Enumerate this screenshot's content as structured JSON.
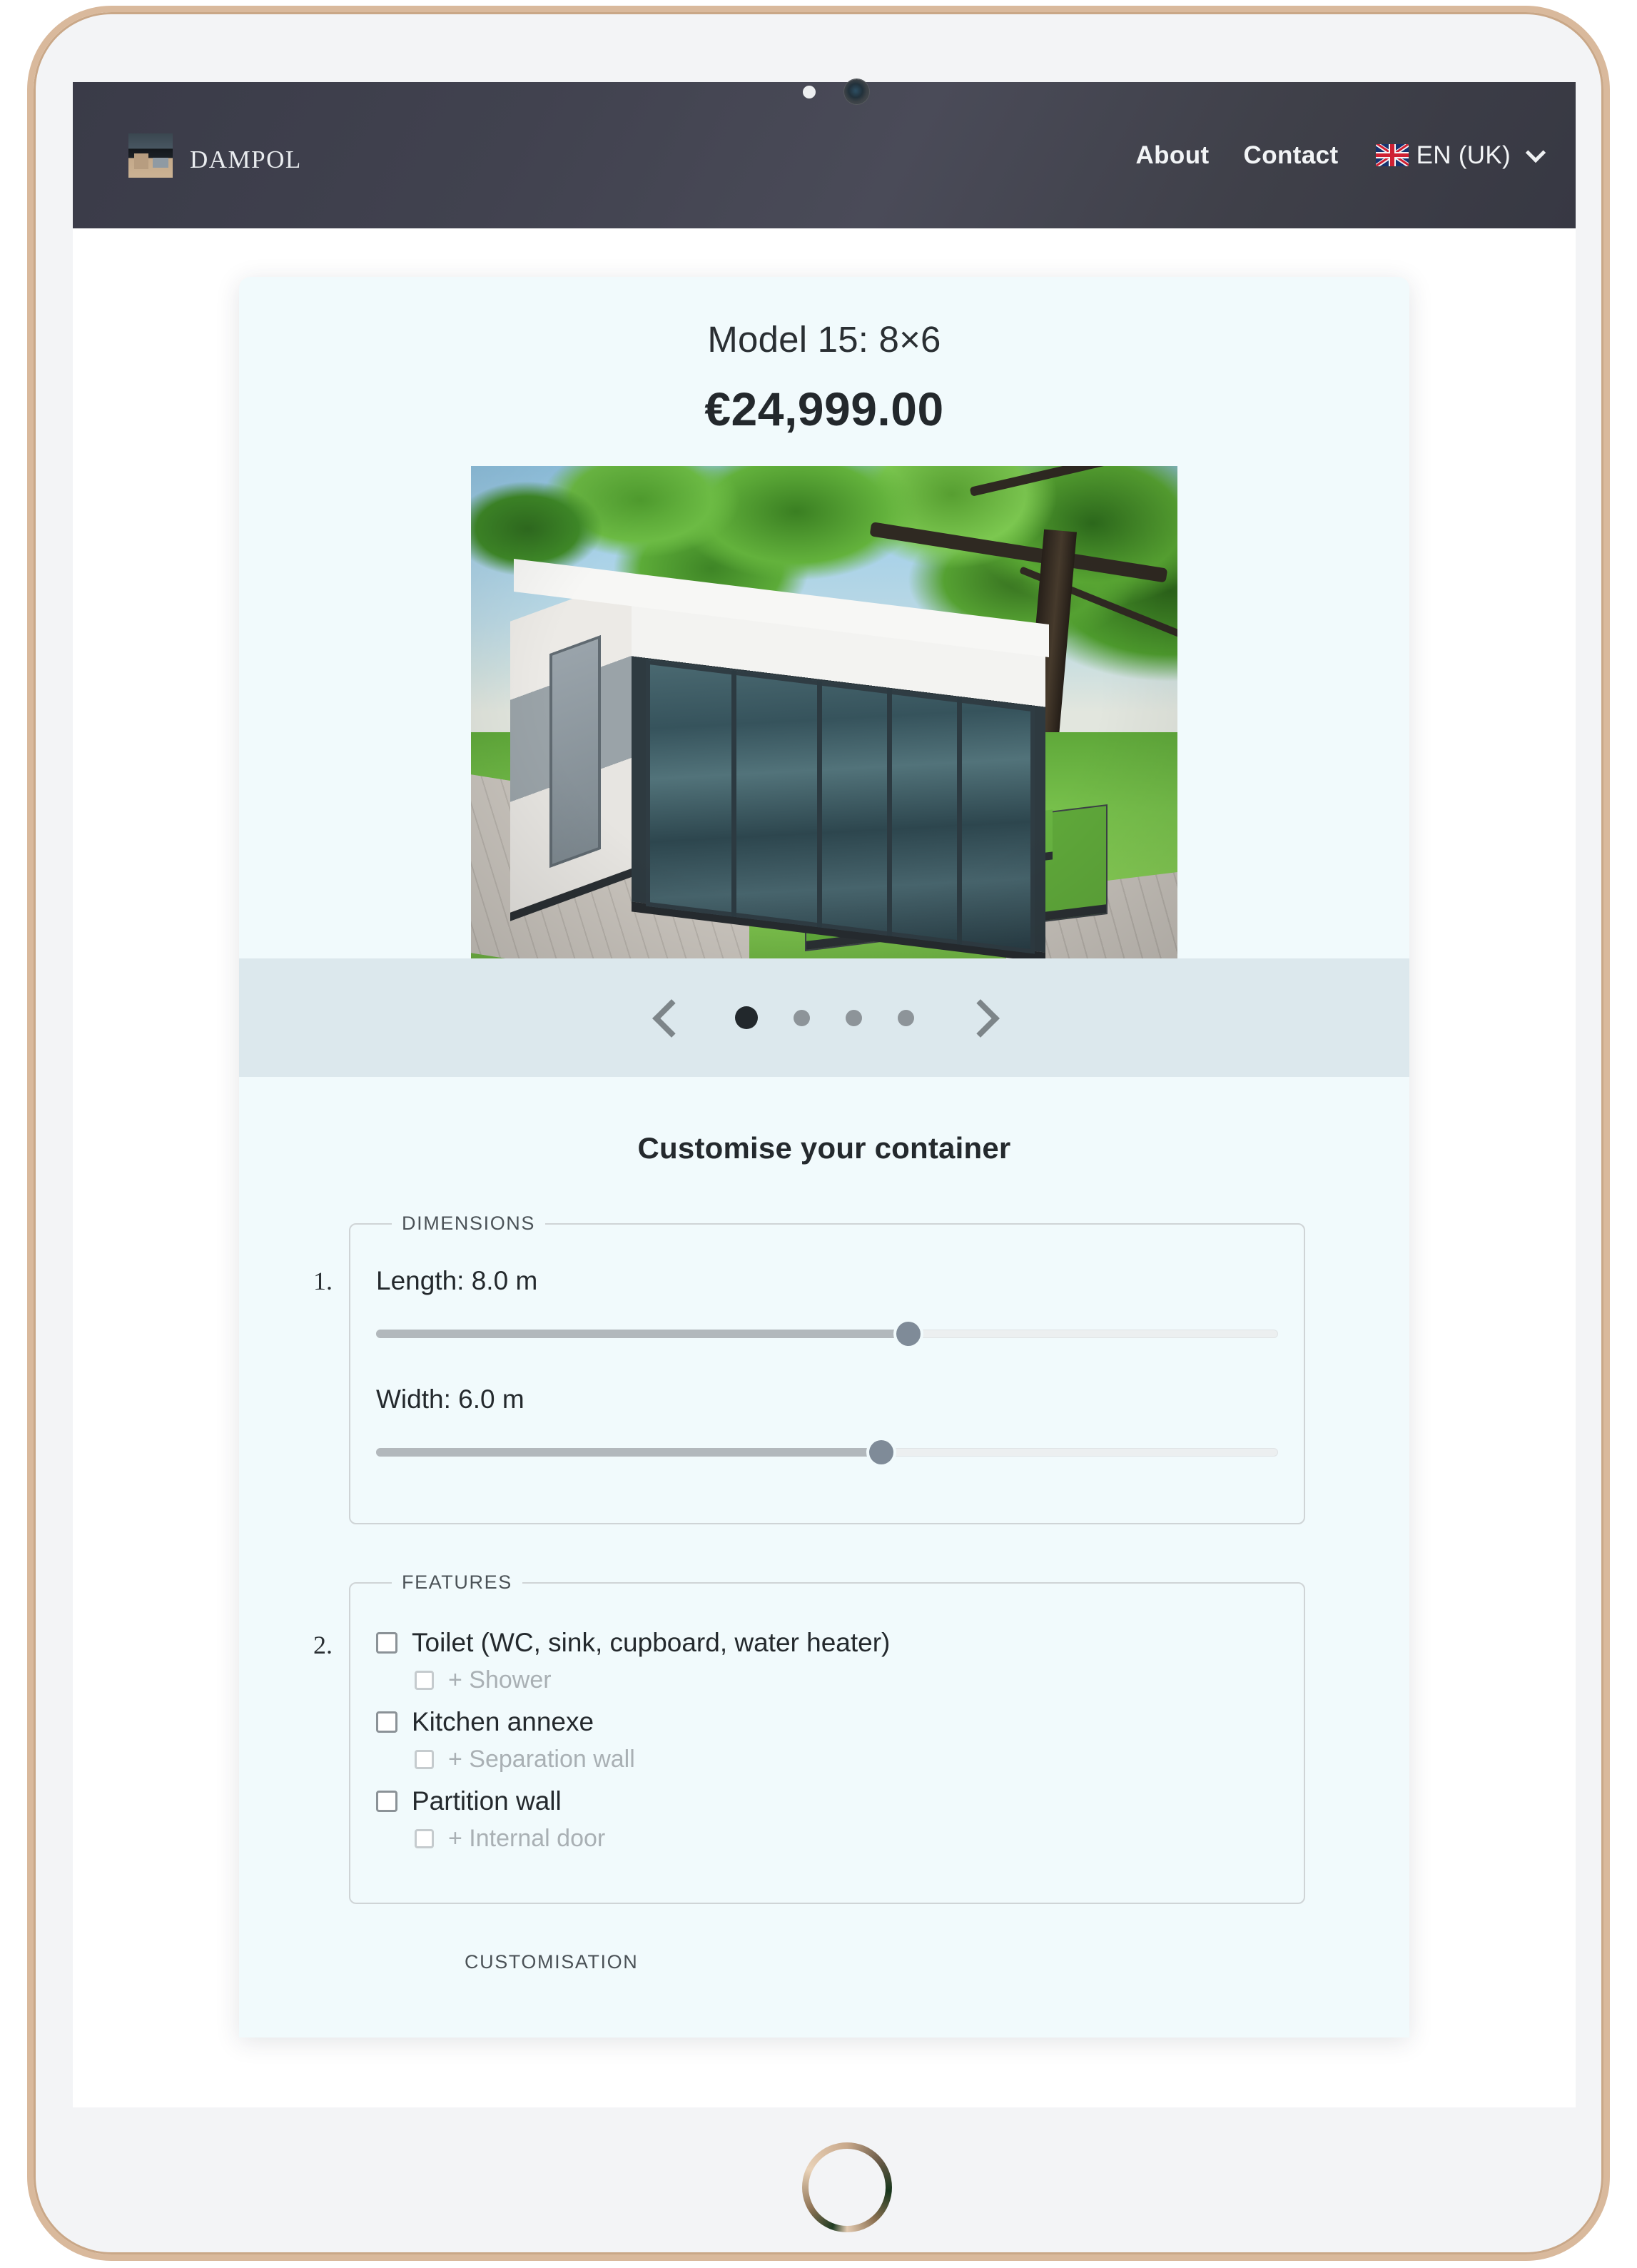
{
  "device": {
    "type": "tablet",
    "front_camera": "camera-lens",
    "light_sensor": "ambient-light-sensor",
    "home_button": "home-button"
  },
  "header": {
    "brand_name": "Dampol",
    "brand_logo": "dampol-logo-image",
    "nav": [
      {
        "label": "About"
      },
      {
        "label": "Contact"
      }
    ],
    "language": {
      "flag": "uk-flag-icon",
      "label": "EN (UK)",
      "chevron": "chevron-down-icon"
    }
  },
  "product": {
    "title": "Model 15: 8×6",
    "price": "€24,999.00",
    "photo_alt": "modular container house with glass facade on lawn"
  },
  "carousel": {
    "prev_icon": "chevron-left-icon",
    "next_icon": "chevron-right-icon",
    "dot_count": 4,
    "active_index": 0
  },
  "customiser": {
    "heading": "Customise your container",
    "steps": [
      {
        "number": "1.",
        "legend": "DIMENSIONS",
        "sliders": [
          {
            "label": "Length: 8.0 m",
            "fill_percent": 59
          },
          {
            "label": "Width: 6.0 m",
            "fill_percent": 56
          }
        ]
      },
      {
        "number": "2.",
        "legend": "FEATURES",
        "checkboxes": [
          {
            "label": "Toilet (WC, sink, cupboard, water heater)",
            "checked": false,
            "sub": false
          },
          {
            "label": "+ Shower",
            "checked": false,
            "sub": true
          },
          {
            "label": "Kitchen annexe",
            "checked": false,
            "sub": false
          },
          {
            "label": "+ Separation wall",
            "checked": false,
            "sub": true
          },
          {
            "label": "Partition wall",
            "checked": false,
            "sub": false
          },
          {
            "label": "+ Internal door",
            "checked": false,
            "sub": true
          }
        ]
      }
    ],
    "next_legend_partial": "CUSTOMISATION"
  },
  "colors": {
    "header_bg": "#3f4049",
    "card_bg": "#f1fafc",
    "carousel_bg": "#dce8ed",
    "text": "#24292d",
    "muted_text": "#a9b0b4",
    "bezel": "#d9b99c"
  }
}
